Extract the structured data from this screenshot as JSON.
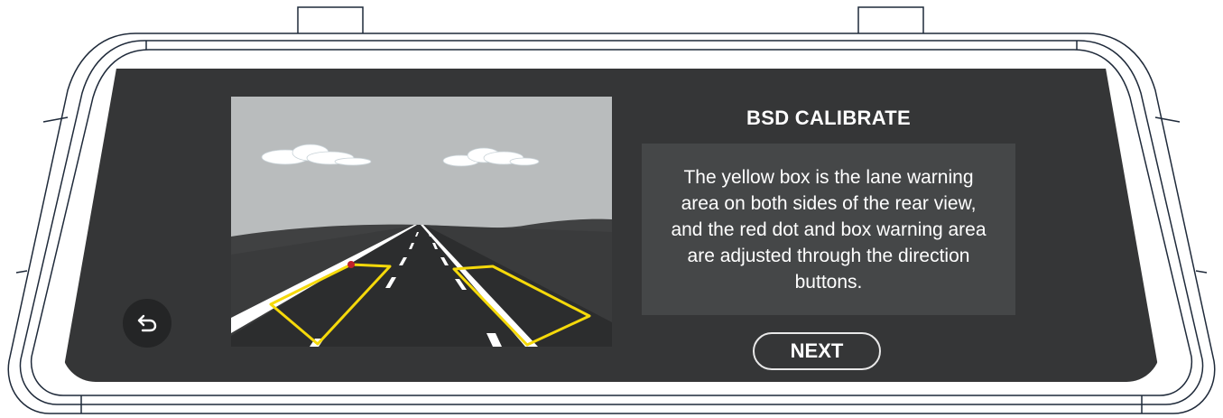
{
  "screen": {
    "title": "BSD CALIBRATE",
    "description": "The yellow box is the lane warning area on both sides of the rear view, and the red dot and box warning area are adjusted through the direction buttons.",
    "next_label": "NEXT",
    "back_icon": "return-arrow-icon"
  },
  "colors": {
    "screen_bg": "#353637",
    "info_box_bg": "#454748",
    "warning_box": "#f5d90a",
    "calibration_dot": "#c0202a",
    "sky": "#b9bcbd"
  }
}
